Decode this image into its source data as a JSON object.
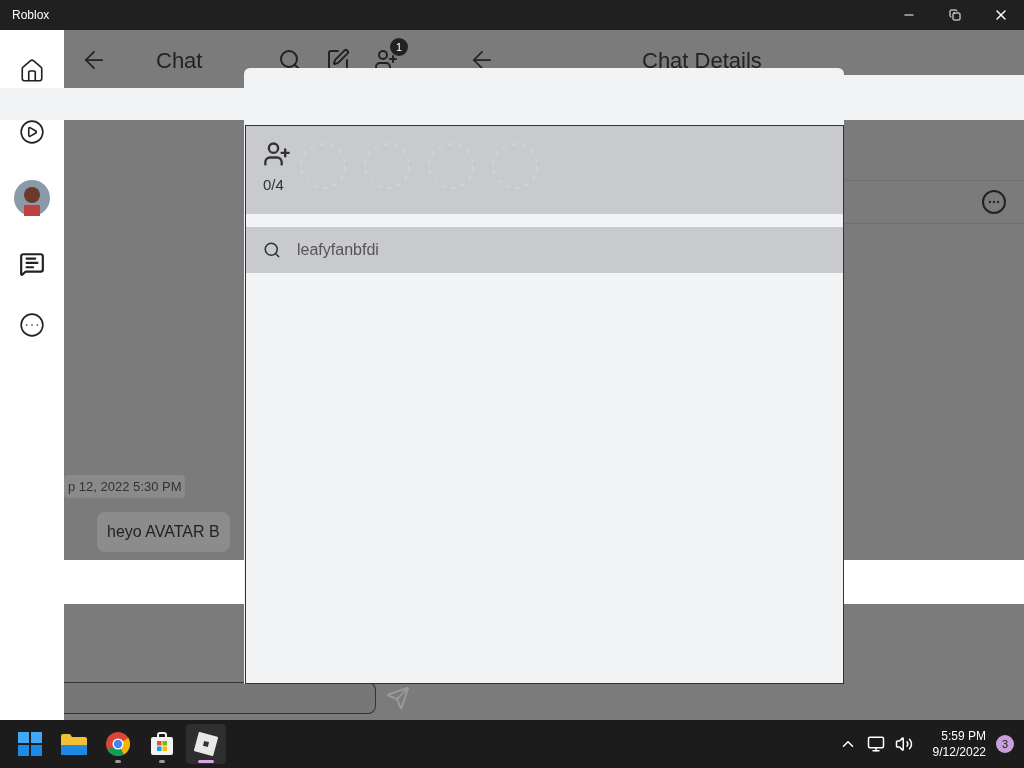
{
  "window": {
    "title": "Roblox"
  },
  "chat_pane": {
    "title": "Chat",
    "badge": "1",
    "messages": [
      {
        "kind": "timestamp",
        "text": "p 12, 2022 5:30 PM"
      },
      {
        "kind": "bubble",
        "text": "heyo AVATAR B"
      }
    ]
  },
  "details_pane": {
    "title": "Chat Details"
  },
  "dialog": {
    "count": "0/4",
    "search": {
      "value": "leafyfanbfdi"
    }
  },
  "taskbar": {
    "apps": [
      {
        "kind": "start",
        "running": false,
        "selected": false
      },
      {
        "kind": "explorer",
        "running": false,
        "selected": false
      },
      {
        "kind": "chrome",
        "running": true,
        "selected": false
      },
      {
        "kind": "store",
        "running": true,
        "selected": false
      },
      {
        "kind": "roblox",
        "running": true,
        "selected": true
      }
    ],
    "time": "5:59 PM",
    "date": "9/12/2022",
    "notifications": "3"
  }
}
